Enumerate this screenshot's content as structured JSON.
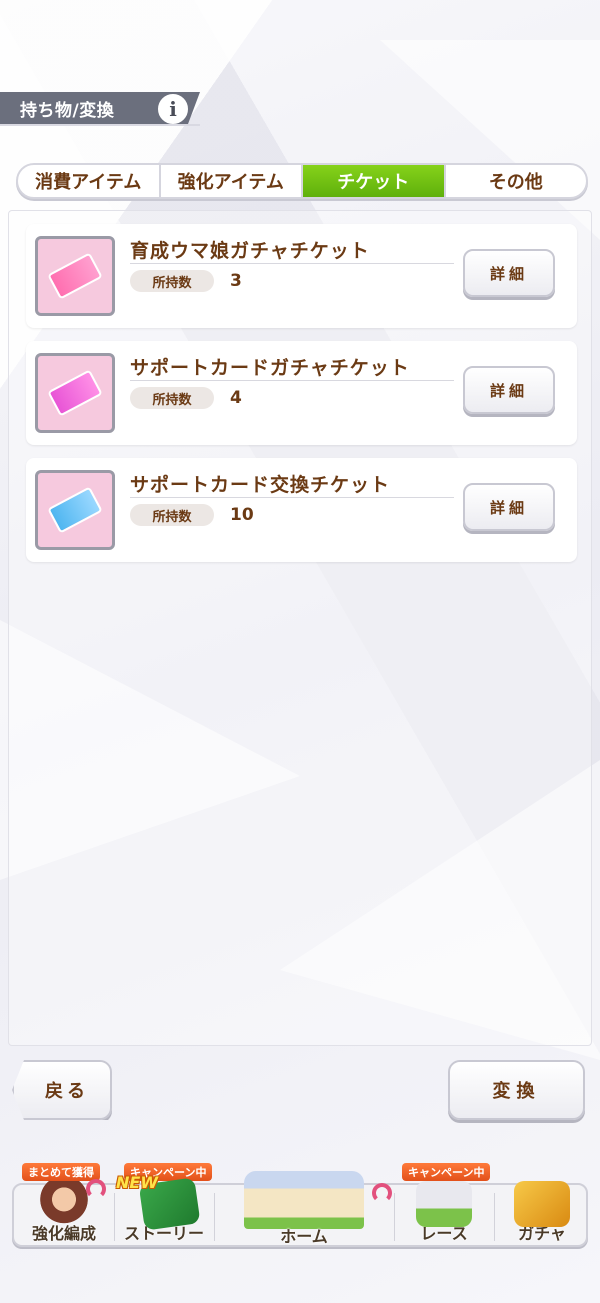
{
  "header": {
    "title": "持ち物/変換",
    "info_icon": "i"
  },
  "tabs": [
    {
      "label": "消費アイテム",
      "active": false
    },
    {
      "label": "強化アイテム",
      "active": false
    },
    {
      "label": "チケット",
      "active": true
    },
    {
      "label": "その他",
      "active": false
    }
  ],
  "items": [
    {
      "name": "育成ウマ娘ガチャチケット",
      "qty_label": "所持数",
      "qty": "3",
      "detail": "詳細",
      "icon": "pink-ticket-icon"
    },
    {
      "name": "サポートカードガチャチケット",
      "qty_label": "所持数",
      "qty": "4",
      "detail": "詳細",
      "icon": "pink-ticket-icon"
    },
    {
      "name": "サポートカード交換チケット",
      "qty_label": "所持数",
      "qty": "10",
      "detail": "詳細",
      "icon": "blue-ticket-icon"
    }
  ],
  "buttons": {
    "back": "戻る",
    "exchange": "変換"
  },
  "nav": {
    "enhance": {
      "label": "強化編成",
      "badge": "まとめて獲得"
    },
    "story": {
      "label": "ストーリー",
      "badge": "キャンペーン中",
      "tag": "NEW"
    },
    "home": {
      "label": "ホーム"
    },
    "race": {
      "label": "レース",
      "badge": "キャンペーン中"
    },
    "gacha": {
      "label": "ガチャ"
    }
  },
  "colors": {
    "active_tab": "#6ec414",
    "text_brown": "#6b3a14",
    "badge_orange": "#e8561e",
    "header_bg": "#6b6f7d"
  }
}
